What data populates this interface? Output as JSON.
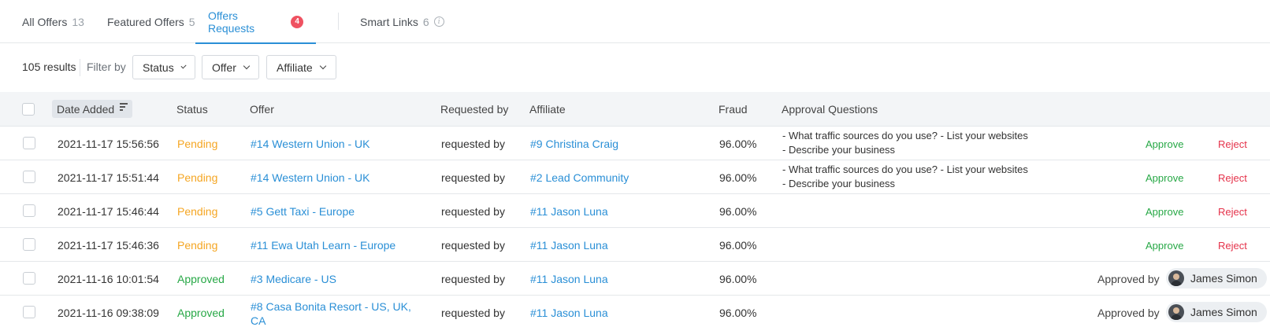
{
  "tabs": [
    {
      "label": "All Offers",
      "count": "13"
    },
    {
      "label": "Featured Offers",
      "count": "5"
    },
    {
      "label": "Offers Requests",
      "badge": "4"
    },
    {
      "label": "Smart Links",
      "count": "6"
    }
  ],
  "filters": {
    "results": "105 results",
    "filter_by": "Filter by",
    "status": "Status",
    "offer": "Offer",
    "affiliate": "Affiliate"
  },
  "table": {
    "headers": {
      "date_added": "Date Added",
      "status": "Status",
      "offer": "Offer",
      "requested_by": "Requested by",
      "affiliate": "Affiliate",
      "fraud": "Fraud",
      "approval_questions": "Approval Questions"
    },
    "rows": [
      {
        "date": "2021-11-17 15:56:56",
        "status": "Pending",
        "offer": "#14 Western Union - UK",
        "requested_by": "requested by",
        "affiliate": "#9 Christina Craig",
        "fraud": "96.00%",
        "q1": "- What traffic sources do you use? - List your websites",
        "q2": "- Describe your business",
        "approve": "Approve",
        "reject": "Reject"
      },
      {
        "date": "2021-11-17 15:51:44",
        "status": "Pending",
        "offer": "#14 Western Union - UK",
        "requested_by": "requested by",
        "affiliate": "#2 Lead Community",
        "fraud": "96.00%",
        "q1": "- What traffic sources do you use? - List your websites",
        "q2": "- Describe your business",
        "approve": "Approve",
        "reject": "Reject"
      },
      {
        "date": "2021-11-17 15:46:44",
        "status": "Pending",
        "offer": "#5 Gett Taxi - Europe",
        "requested_by": "requested by",
        "affiliate": "#11 Jason Luna",
        "fraud": "96.00%",
        "approve": "Approve",
        "reject": "Reject"
      },
      {
        "date": "2021-11-17 15:46:36",
        "status": "Pending",
        "offer": "#11 Ewa Utah Learn - Europe",
        "requested_by": "requested by",
        "affiliate": "#11 Jason Luna",
        "fraud": "96.00%",
        "approve": "Approve",
        "reject": "Reject"
      },
      {
        "date": "2021-11-16 10:01:54",
        "status": "Approved",
        "offer": "#3 Medicare - US",
        "requested_by": "requested by",
        "affiliate": "#11 Jason Luna",
        "fraud": "96.00%",
        "approved_by": "Approved by",
        "approver": "James Simon"
      },
      {
        "date": "2021-11-16 09:38:09",
        "status": "Approved",
        "offer_line1": "#8 Casa Bonita Resort - US, UK,",
        "offer_line2": "CA",
        "requested_by": "requested by",
        "affiliate": "#11 Jason Luna",
        "fraud": "96.00%",
        "approved_by": "Approved by",
        "approver": "James Simon"
      }
    ]
  },
  "colors": {
    "accent": "#2a8fd6",
    "pending": "#f5a623",
    "approved": "#27a846",
    "reject": "#e5334b",
    "badge": "#ef5261"
  }
}
